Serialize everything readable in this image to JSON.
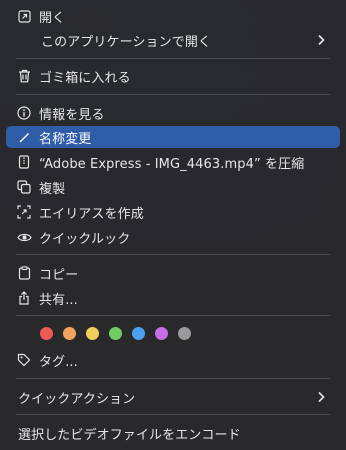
{
  "menu": {
    "open": "開く",
    "open_with": "このアプリケーションで開く",
    "move_to_trash": "ゴミ箱に入れる",
    "get_info": "情報を見る",
    "rename": "名称変更",
    "compress": "“Adobe Express - IMG_4463.mp4” を圧縮",
    "duplicate": "複製",
    "make_alias": "エイリアスを作成",
    "quick_look": "クイックルック",
    "copy": "コピー",
    "share": "共有...",
    "tags_label": "タグ...",
    "quick_actions": "クイックアクション",
    "encode": "選択したビデオファイルをエンコード"
  },
  "tag_colors": [
    {
      "name": "red",
      "color": "#ee5b56"
    },
    {
      "name": "orange",
      "color": "#f0a35c"
    },
    {
      "name": "yellow",
      "color": "#f2cf5a"
    },
    {
      "name": "green",
      "color": "#6fce62"
    },
    {
      "name": "blue",
      "color": "#4d9ff2"
    },
    {
      "name": "purple",
      "color": "#c86be6"
    },
    {
      "name": "gray",
      "color": "#9a9a9e"
    }
  ],
  "colors": {
    "highlight": "#2f5da8",
    "menu_bg": "#2a2a2d"
  }
}
